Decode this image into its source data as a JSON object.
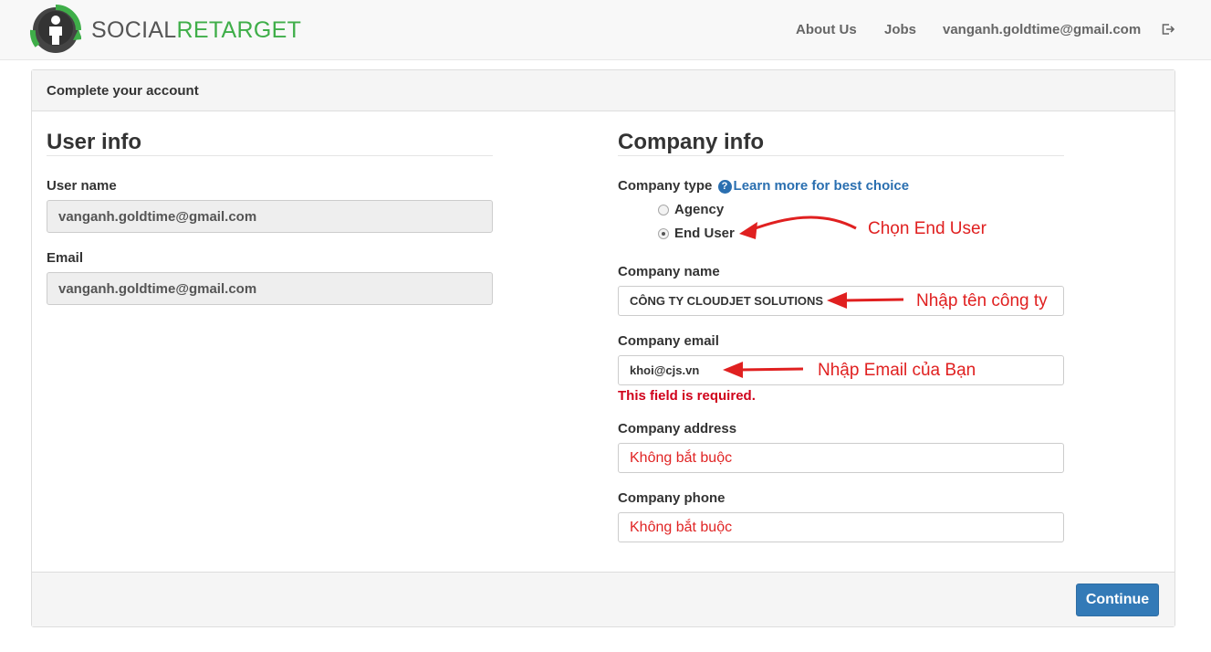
{
  "brand": {
    "word1": "SOCIAL",
    "word2": "RETARGET",
    "logo_icon": "person-refresh-icon"
  },
  "nav": {
    "about": "About Us",
    "jobs": "Jobs",
    "account": "vanganh.goldtime@gmail.com",
    "logout_icon": "sign-out-icon"
  },
  "panel": {
    "title": "Complete your account"
  },
  "user_info": {
    "title": "User info",
    "username_label": "User name",
    "username_value": "vanganh.goldtime@gmail.com",
    "email_label": "Email",
    "email_value": "vanganh.goldtime@gmail.com"
  },
  "company_info": {
    "title": "Company info",
    "type_label": "Company type",
    "help_icon": "?",
    "learn_more": "Learn more for best choice",
    "options": [
      {
        "label": "Agency",
        "checked": false
      },
      {
        "label": "End User",
        "checked": true
      }
    ],
    "name_label": "Company name",
    "name_value": "CÔNG TY CLOUDJET SOLUTIONS",
    "email_label": "Company email",
    "email_value": "khoi@cjs.vn",
    "email_error": "This field is required.",
    "address_label": "Company address",
    "address_value": "Không bắt buộc",
    "phone_label": "Company phone",
    "phone_value": "Không bắt buộc"
  },
  "annotations": {
    "end_user": "Chọn End User",
    "company_name": "Nhập tên công ty",
    "email": "Nhập Email của Bạn",
    "color": "#e02020"
  },
  "footer": {
    "continue": "Continue"
  },
  "colors": {
    "brand_green": "#3fae49",
    "primary": "#337ab7",
    "error": "#d0021b"
  }
}
